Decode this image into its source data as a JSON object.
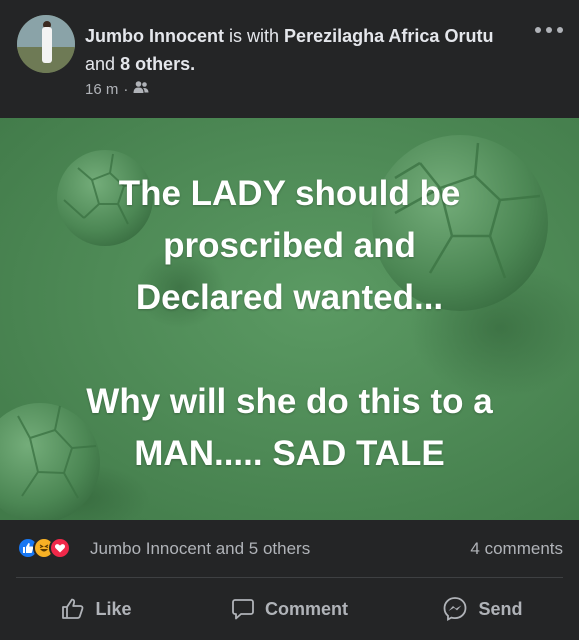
{
  "post": {
    "author": "Jumbo Innocent",
    "with_text": "is with",
    "tagged": "Perezilagha Africa Orutu",
    "and_text": "and",
    "others": "8 others.",
    "time": "16 m",
    "separator": "·",
    "audience_icon": "friends-icon"
  },
  "image_text": {
    "line1": "The LADY should be",
    "line2": "proscribed and",
    "line3": "Declared wanted...",
    "line4": "Why will she do this to a",
    "line5": "MAN..... SAD TALE"
  },
  "reactions": {
    "icons": [
      "like-reaction-icon",
      "haha-reaction-icon",
      "love-reaction-icon"
    ],
    "summary": "Jumbo Innocent and 5 others",
    "comments": "4 comments"
  },
  "actions": {
    "like": "Like",
    "comment": "Comment",
    "send": "Send"
  },
  "colors": {
    "background": "#242526",
    "image_green": "#4f8a57",
    "text_primary": "#e4e6eb",
    "text_secondary": "#b0b3b8",
    "like_blue": "#1877f2",
    "love_red": "#f02849",
    "haha_yellow": "#f7b125"
  }
}
